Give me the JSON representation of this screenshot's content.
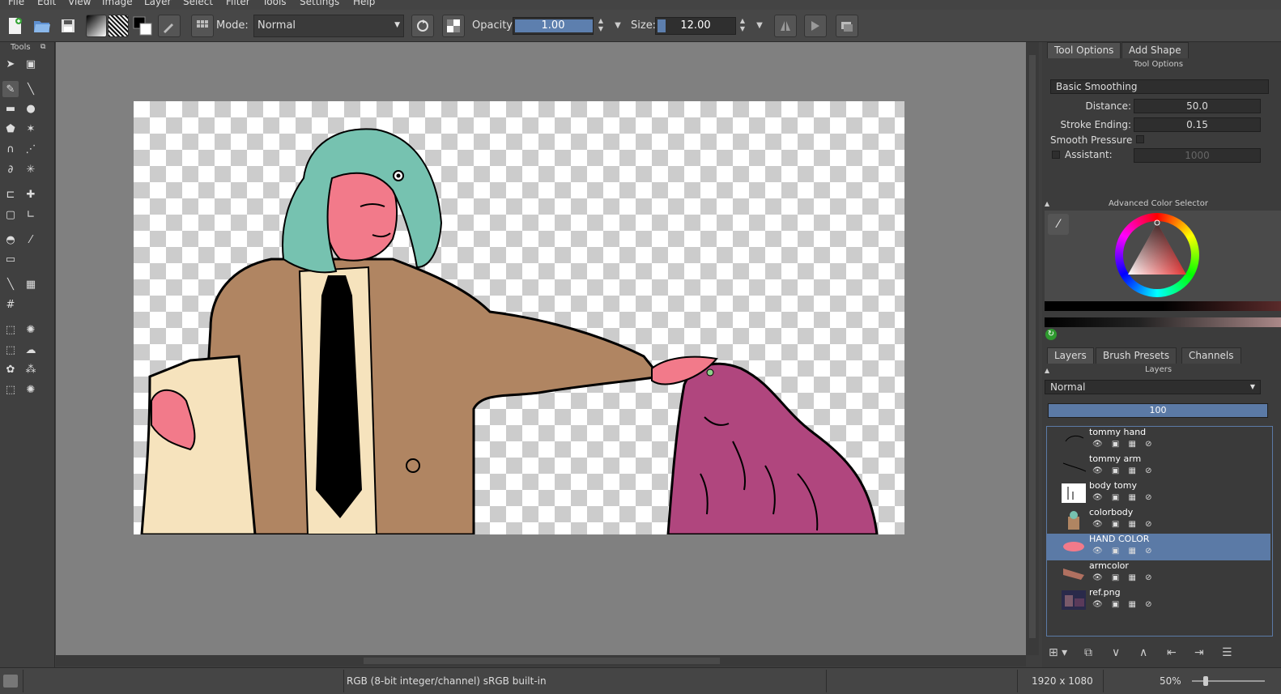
{
  "menu": [
    "File",
    "Edit",
    "View",
    "Image",
    "Layer",
    "Select",
    "Filter",
    "Tools",
    "Settings",
    "Help"
  ],
  "toolbar": {
    "mode_label": "Mode:",
    "mode_value": "Normal",
    "opacity_label": "Opacity:",
    "opacity_value": "1.00",
    "opacity_fraction": 1.0,
    "size_label": "Size:",
    "size_value": "12.00",
    "size_fraction": 0.1
  },
  "toolbox": {
    "title": "Tools"
  },
  "dock": {
    "tabs": [
      "Tool Options",
      "Add Shape"
    ],
    "tool_options_title": "Tool Options",
    "smoothing_value": "Basic Smoothing",
    "distance_label": "Distance:",
    "distance_value": "50.0",
    "stroke_ending_label": "Stroke Ending:",
    "stroke_ending_value": "0.15",
    "smooth_pressure_label": "Smooth Pressure",
    "assistant_label": "Assistant:",
    "assistant_value": "1000",
    "color_selector_title": "Advanced Color Selector",
    "layer_tabs": [
      "Layers",
      "Brush Presets",
      "Channels"
    ],
    "layers_title": "Layers",
    "blend_mode": "Normal",
    "layer_opacity": "100",
    "layers": [
      {
        "name": "tommy hand",
        "selected": false
      },
      {
        "name": "tommy arm",
        "selected": false
      },
      {
        "name": "body tomy",
        "selected": false
      },
      {
        "name": "colorbody",
        "selected": false
      },
      {
        "name": "HAND COLOR",
        "selected": true
      },
      {
        "name": "armcolor",
        "selected": false
      },
      {
        "name": "ref.png",
        "selected": false
      }
    ]
  },
  "status": {
    "color_space": "RGB (8-bit integer/channel)  sRGB built-in",
    "dimensions": "1920 x 1080",
    "zoom": "50%"
  },
  "colors": {
    "accent": "#5b7aa6",
    "hair": "#76c2b0",
    "skin": "#f27a8a",
    "coat": "#b08562",
    "shirt": "#f6e3bd",
    "creature": "#b0467e"
  }
}
